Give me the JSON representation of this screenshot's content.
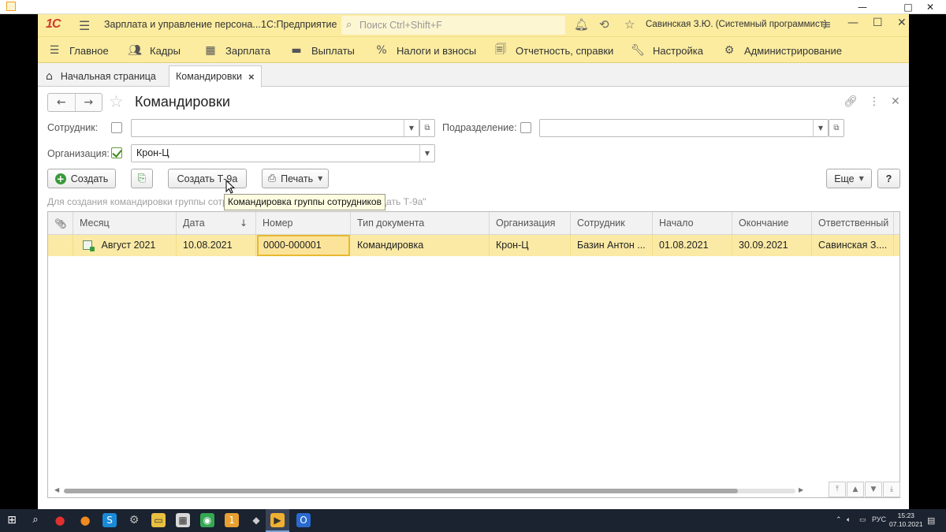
{
  "window": {
    "minimize": "—",
    "maximize": "□",
    "close": "✕"
  },
  "topbar": {
    "logo": "1С",
    "app_title": "Зарплата и управление персона...",
    "platform": "1С:Предприятие",
    "search_placeholder": "Поиск Ctrl+Shift+F",
    "user": "Савинская З.Ю. (Системный программист)"
  },
  "menu": [
    {
      "icon": "hamburger-icon",
      "label": "Главное"
    },
    {
      "icon": "people-icon",
      "label": "Кадры"
    },
    {
      "icon": "calculator-icon",
      "label": "Зарплата"
    },
    {
      "icon": "wallet-icon",
      "label": "Выплаты"
    },
    {
      "icon": "percent-icon",
      "label": "Налоги и взносы"
    },
    {
      "icon": "report-icon",
      "label": "Отчетность, справки"
    },
    {
      "icon": "wrench-icon",
      "label": "Настройка"
    },
    {
      "icon": "gear-icon",
      "label": "Администрирование"
    }
  ],
  "tabs": [
    {
      "label": "Начальная страница"
    },
    {
      "label": "Командировки",
      "close": "×"
    }
  ],
  "form": {
    "title": "Командировки",
    "filters": {
      "employee_label": "Сотрудник:",
      "employee_value": "",
      "employee_checked": false,
      "department_label": "Подразделение:",
      "department_value": "",
      "department_checked": false,
      "organization_label": "Организация:",
      "organization_value": "Крон-Ц",
      "organization_checked": true
    },
    "toolbar": {
      "create": "Создать",
      "create_t9a": "Создать Т-9а",
      "print": "Печать",
      "more": "Еще",
      "help": "?"
    },
    "hint": "Для создания командировки группы сотрудников используйте команду \"Создать Т-9а\"",
    "tooltip": "Командировка группы сотрудников"
  },
  "table": {
    "columns": [
      "",
      "Месяц",
      "Дата",
      "Номер",
      "Тип документа",
      "Организация",
      "Сотрудник",
      "Начало",
      "Окончание",
      "Ответственный"
    ],
    "rows": [
      {
        "month": "Август 2021",
        "date": "10.08.2021",
        "number": "0000-000001",
        "doc_type": "Командировка",
        "organization": "Крон-Ц",
        "employee": "Базин Антон ...",
        "start": "01.08.2021",
        "end": "30.09.2021",
        "responsible": "Савинская З...."
      }
    ]
  },
  "taskbar": {
    "lang": "РУС",
    "time": "15:23",
    "date": "07.10.2021"
  },
  "colors": {
    "accent_yellow": "#fbeca0",
    "row_selected": "#fbeaa5",
    "logo_red": "#d23a2b"
  }
}
